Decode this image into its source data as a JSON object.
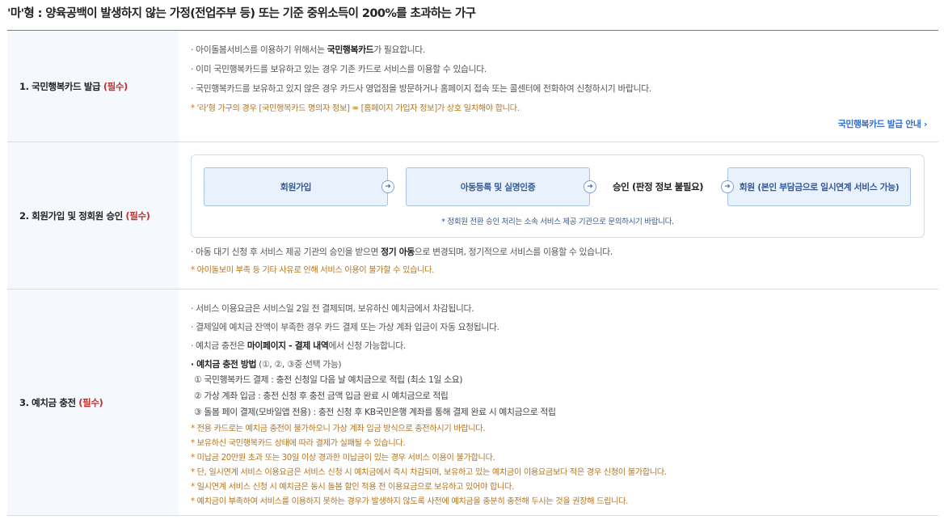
{
  "title": "'마'형 : 양육공백이 발생하지 않는 가정(전업주부 등) 또는 기준 중위소득이 200%를 초과하는 가구",
  "required_label": "(필수)",
  "row1": {
    "head": "1. 국민행복카드 발급",
    "line1_pre": "· 아이돌봄서비스를 이용하기 위해서는 ",
    "line1_strong": "국민행복카드",
    "line1_post": "가 필요합니다.",
    "line2": "· 이미 국민행복카드를 보유하고 있는 경우 기존 카드로 서비스를 이용할 수 있습니다.",
    "line3": "· 국민행복카드를 보유하고 있지 않은 경우 카드사 영업점을 방문하거나 홈페이지 접속 또는 콜센터에 전화하여 신청하시기 바랍니다.",
    "note": "* '라'형 가구의 경우 [국민행복카드 명의자 정보] = [홈페이지 가입자 정보]가 상호 일치해야 합니다.",
    "link": "국민행복카드 발급 안내",
    "link_arrow": "›"
  },
  "row2": {
    "head": "2. 회원가입 및 정회원 승인",
    "steps": [
      "회원가입",
      "아동등록 및 실명인증",
      "승인 (판정 정보 불필요)",
      "회원 (본인 부담금으로 일시연계 서비스 가능)"
    ],
    "arrow_glyph": "➜",
    "flow_note": "* 정회원 전환 승인 처리는 소속 서비스 제공 기관으로 문의하시기 바랍니다.",
    "line1_pre": "· 아동 대기 신청 후 서비스 제공 기관의 승인을 받으면 ",
    "line1_strong": "정기 아동",
    "line1_post": "으로 변경되며, 정기적으로 서비스를 이용할 수 있습니다.",
    "note": "* 아이돌보미 부족 등 기타 사유로 인해 서비스 이용이 불가할 수 있습니다."
  },
  "row3": {
    "head": "3. 예치금 충전",
    "line1": "· 서비스 이용요금은 서비스일 2일 전 결제되며, 보유하신 예치금에서 차감됩니다.",
    "line2": "· 결제일에 예치금 잔액이 부족한 경우 카드 결제 또는 가상 계좌 입금이 자동 요청됩니다.",
    "line3_pre": "· 예치금 충전은 ",
    "line3_strong": "마이페이지 - 결제 내역",
    "line3_post": "에서 신청 가능합니다.",
    "method_strong": "· 예치금 충전 방법",
    "method_post": " (①, ②, ③중 선택 가능)",
    "sub1": "① 국민행복카드 결제 : 충전 신청일 다음 날 예치금으로 적립 (최소 1일 소요)",
    "sub2": "② 가상 계좌 입금 : 충전 신청 후 충전 금액 입금 완료 시 예치금으로 적립",
    "sub3": "③ 돌봄 페이 결제(모바일앱 전용) : 충전 신청 후 KB국민은행 계좌를 통해 결제 완료 시 예치금으로 적립",
    "notes": [
      "* 전용 카드로는 예치금 충전이 불가하오니 가상 계좌 입금 방식으로 충전하시기 바랍니다.",
      "* 보유하신 국민행복카드 상태에 따라 결제가 실패될 수 있습니다.",
      "* 미납금 20만원 초과 또는 30일 이상 경과한 미납금이 있는 경우 서비스 이용이 불가합니다.",
      "* 단, 일시연계 서비스 이용요금은 서비스 신청 시 예치금에서 즉시 차감되며, 보유하고 있는 예치금이 이용요금보다 적은 경우 신청이 불가합니다.",
      "* 일시연계 서비스 신청 시 예치금은 동시 돌봄 할인 적용 전 이용요금으로 보유하고 있어야 합니다.",
      "* 예치금이 부족하여 서비스를 이용하지 못하는 경우가 발생하지 않도록 사전에 예치금을 충분히 충전해 두시는 것을 권장해 드립니다."
    ]
  }
}
